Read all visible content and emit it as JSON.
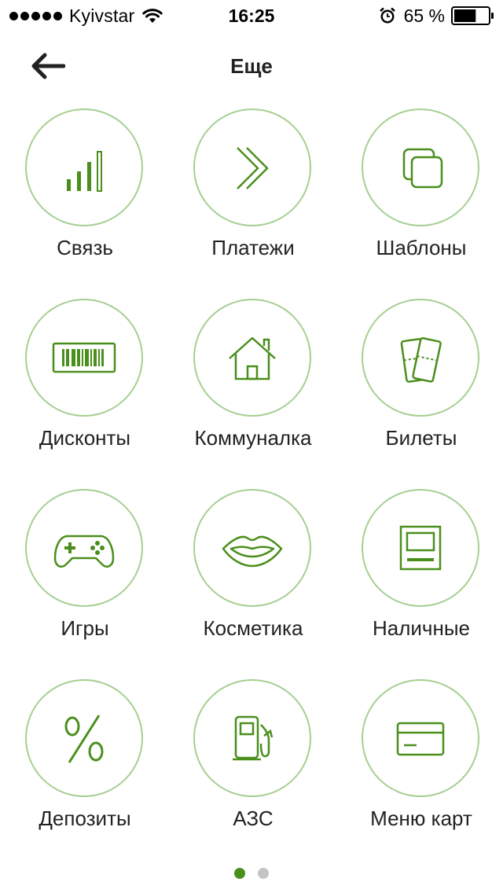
{
  "status_bar": {
    "carrier": "Kyivstar",
    "time": "16:25",
    "battery_percent": "65 %",
    "signal_bars": 5,
    "battery_level": 0.65
  },
  "nav": {
    "title": "Еще",
    "back_icon": "arrow-left-icon"
  },
  "colors": {
    "accent": "#4a8f1c",
    "circle_border": "#a6cf92",
    "dot_active": "#4a8f1c",
    "dot_inactive": "#c4c4c4"
  },
  "grid": {
    "items": [
      {
        "label": "Связь",
        "icon": "signal-bars-icon"
      },
      {
        "label": "Платежи",
        "icon": "double-chevron-icon"
      },
      {
        "label": "Шаблоны",
        "icon": "copy-icon"
      },
      {
        "label": "Дисконты",
        "icon": "barcode-icon"
      },
      {
        "label": "Коммуналка",
        "icon": "house-icon"
      },
      {
        "label": "Билеты",
        "icon": "tickets-icon"
      },
      {
        "label": "Игры",
        "icon": "gamepad-icon"
      },
      {
        "label": "Косметика",
        "icon": "lips-icon"
      },
      {
        "label": "Наличные",
        "icon": "atm-icon"
      },
      {
        "label": "Депозиты",
        "icon": "percent-icon"
      },
      {
        "label": "АЗС",
        "icon": "fuel-pump-icon"
      },
      {
        "label": "Меню карт",
        "icon": "credit-card-icon"
      }
    ]
  },
  "pagination": {
    "pages": 2,
    "active": 0
  }
}
